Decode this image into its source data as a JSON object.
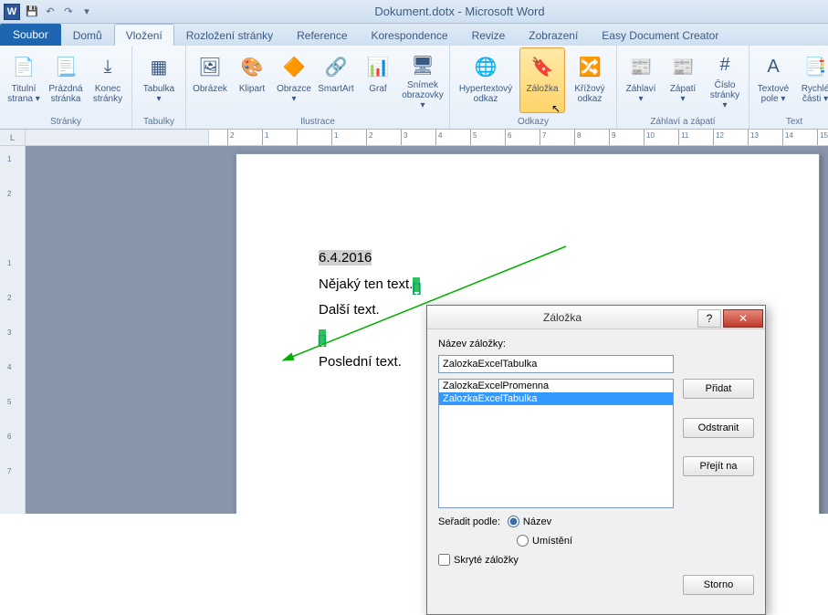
{
  "window": {
    "title": "Dokument.dotx - Microsoft Word",
    "app_letter": "W"
  },
  "qat": {
    "save": "💾",
    "undo": "↶",
    "redo": "↷",
    "more": "▾"
  },
  "tabs": {
    "file": "Soubor",
    "items": [
      "Domů",
      "Vložení",
      "Rozložení stránky",
      "Reference",
      "Korespondence",
      "Revize",
      "Zobrazení",
      "Easy Document Creator"
    ],
    "active_index": 1
  },
  "ribbon": {
    "pages": {
      "label": "Stránky",
      "cover": "Titulní\nstrana ▾",
      "blank": "Prázdná\nstránka",
      "break": "Konec\nstránky"
    },
    "tables": {
      "label": "Tabulky",
      "table": "Tabulka\n▾"
    },
    "illus": {
      "label": "Ilustrace",
      "picture": "Obrázek",
      "clipart": "Klipart",
      "shapes": "Obrazce\n▾",
      "smartart": "SmartArt",
      "chart": "Graf",
      "screenshot": "Snímek\nobrazovky ▾"
    },
    "links": {
      "label": "Odkazy",
      "hyperlink": "Hypertextový\nodkaz",
      "bookmark": "Záložka",
      "crossref": "Křížový\nodkaz"
    },
    "hf": {
      "label": "Záhlaví a zápatí",
      "header": "Záhlaví\n▾",
      "footer": "Zápatí\n▾",
      "pagenum": "Číslo\nstránky ▾"
    },
    "text": {
      "label": "Text",
      "textbox": "Textové\npole ▾",
      "quick": "Rychlé\nčásti ▾"
    }
  },
  "ruler": {
    "corner": "L",
    "marks": [
      "2",
      "1",
      "",
      "1",
      "2",
      "3",
      "4",
      "5",
      "6",
      "7",
      "8",
      "9",
      "10",
      "11",
      "12",
      "13",
      "14",
      "15"
    ]
  },
  "vruler": {
    "marks": [
      "1",
      "2",
      "",
      "1",
      "2",
      "3",
      "4",
      "5",
      "6",
      "7"
    ]
  },
  "doc": {
    "date": "6.4.2016",
    "line1_a": "Nějaký ten text.",
    "line2": "Další text.",
    "line3": "Poslední text."
  },
  "dialog": {
    "title": "Záložka",
    "help": "?",
    "close": "✕",
    "name_label": "Název záložky:",
    "name_value": "ZalozkaExcelTabulka",
    "items": [
      "ZalozkaExcelPromenna",
      "ZalozkaExcelTabulka"
    ],
    "selected_index": 1,
    "add": "Přidat",
    "delete": "Odstranit",
    "goto": "Přejít na",
    "sort_label": "Seřadit podle:",
    "sort_name": "Název",
    "sort_loc": "Umístění",
    "hidden": "Skryté záložky",
    "cancel": "Storno"
  }
}
